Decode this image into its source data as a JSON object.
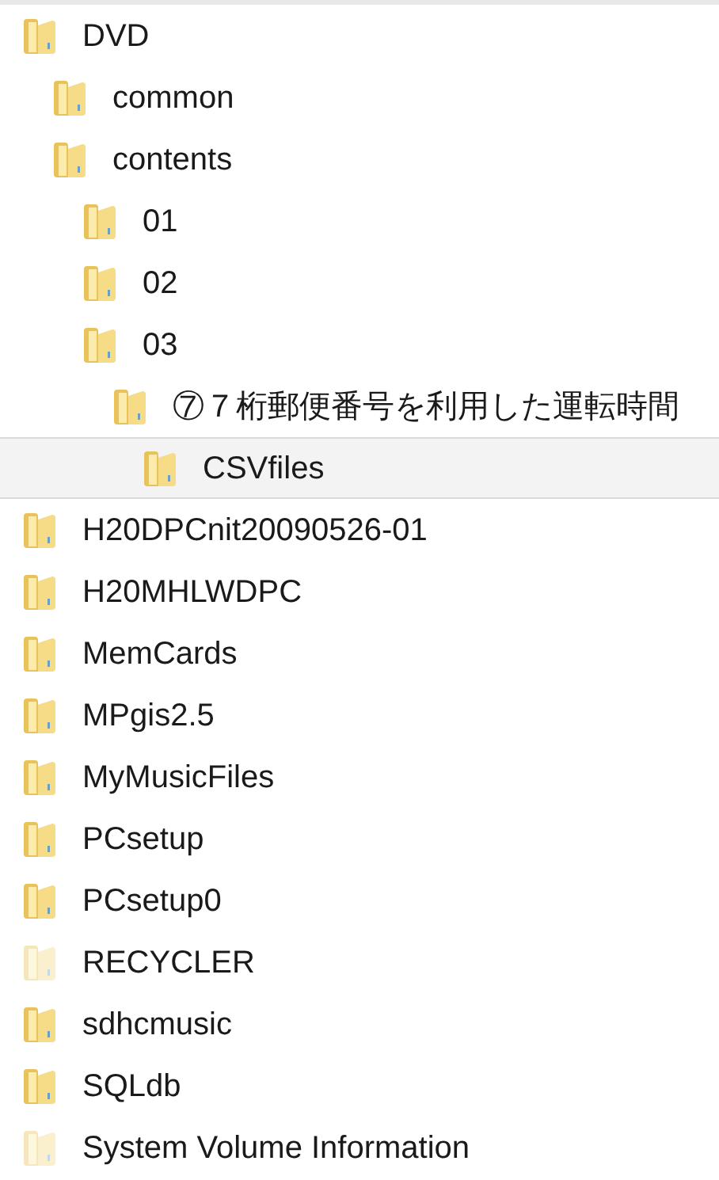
{
  "folder_tree": [
    {
      "name": "DVD",
      "hidden": false,
      "selected": false,
      "children": [
        {
          "name": "common",
          "hidden": false,
          "selected": false
        },
        {
          "name": "contents",
          "hidden": false,
          "selected": false,
          "children": [
            {
              "name": "01",
              "hidden": false,
              "selected": false
            },
            {
              "name": "02",
              "hidden": false,
              "selected": false
            },
            {
              "name": "03",
              "hidden": false,
              "selected": false,
              "children": [
                {
                  "name": "⑦７桁郵便番号を利用した運転時間",
                  "hidden": false,
                  "selected": false,
                  "children": [
                    {
                      "name": "CSVfiles",
                      "hidden": false,
                      "selected": true
                    }
                  ]
                }
              ]
            }
          ]
        }
      ]
    },
    {
      "name": "H20DPCnit20090526-01",
      "hidden": false,
      "selected": false
    },
    {
      "name": "H20MHLWDPC",
      "hidden": false,
      "selected": false
    },
    {
      "name": "MemCards",
      "hidden": false,
      "selected": false
    },
    {
      "name": "MPgis2.5",
      "hidden": false,
      "selected": false
    },
    {
      "name": "MyMusicFiles",
      "hidden": false,
      "selected": false
    },
    {
      "name": "PCsetup",
      "hidden": false,
      "selected": false
    },
    {
      "name": "PCsetup0",
      "hidden": false,
      "selected": false
    },
    {
      "name": "RECYCLER",
      "hidden": true,
      "selected": false
    },
    {
      "name": "sdhcmusic",
      "hidden": false,
      "selected": false
    },
    {
      "name": "SQLdb",
      "hidden": false,
      "selected": false
    },
    {
      "name": "System Volume Information",
      "hidden": true,
      "selected": false
    }
  ]
}
